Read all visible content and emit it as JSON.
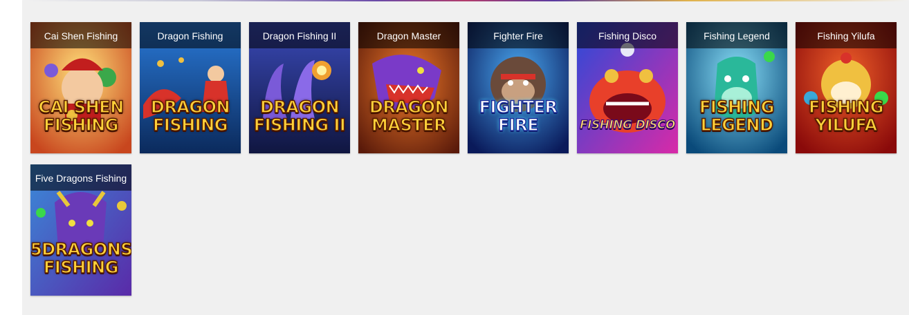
{
  "games": [
    {
      "title": "Cai Shen Fishing",
      "logo_line1": "CAI SHEN",
      "logo_line2": "FISHING",
      "colors": {
        "bg1": "#e8b23a",
        "bg2": "#c23a1e",
        "accent": "#3aa84a"
      },
      "art": "cai-shen-fishing-thumbnail"
    },
    {
      "title": "Dragon Fishing",
      "logo_line1": "DRAGON",
      "logo_line2": "FISHING",
      "colors": {
        "bg1": "#1d5fa8",
        "bg2": "#0b2a5c",
        "accent": "#d8322a"
      },
      "art": "dragon-fishing-thumbnail"
    },
    {
      "title": "Dragon Fishing II",
      "logo_line1": "DRAGON",
      "logo_line2": "FISHING II",
      "colors": {
        "bg1": "#2a2f8a",
        "bg2": "#101640",
        "accent": "#7a5ad8"
      },
      "art": "dragon-fishing-2-thumbnail"
    },
    {
      "title": "Dragon Master",
      "logo_line1": "DRAGON",
      "logo_line2": "MASTER",
      "colors": {
        "bg1": "#d65a1e",
        "bg2": "#5a1a0a",
        "accent": "#7a3ac8"
      },
      "art": "dragon-master-thumbnail"
    },
    {
      "title": "Fighter Fire",
      "logo_line1": "FIGHTER",
      "logo_line2": "FIRE",
      "colors": {
        "bg1": "#2a7ad8",
        "bg2": "#0a1a5a",
        "accent": "#7a5a3a"
      },
      "art": "fighter-fire-thumbnail"
    },
    {
      "title": "Fishing Disco",
      "logo_line1": "FISHING DISCO",
      "logo_line2": "",
      "colors": {
        "bg1": "#2a4ad8",
        "bg2": "#d82aa8",
        "accent": "#e8402a"
      },
      "art": "fishing-disco-thumbnail"
    },
    {
      "title": "Fishing Legend",
      "logo_line1": "FISHING",
      "logo_line2": "LEGEND",
      "colors": {
        "bg1": "#3ab8e8",
        "bg2": "#0a4a7a",
        "accent": "#2ab89a"
      },
      "art": "fishing-legend-thumbnail"
    },
    {
      "title": "Fishing Yilufa",
      "logo_line1": "FISHING",
      "logo_line2": "YILUFA",
      "colors": {
        "bg1": "#e83a1e",
        "bg2": "#8a0a0a",
        "accent": "#f0c040"
      },
      "art": "fishing-yilufa-thumbnail"
    },
    {
      "title": "Five Dragons Fishing",
      "logo_line1": "5DRAGONS",
      "logo_line2": "FISHING",
      "colors": {
        "bg1": "#3a8ad8",
        "bg2": "#5a2aa8",
        "accent": "#e8c83a"
      },
      "art": "five-dragons-fishing-thumbnail"
    }
  ]
}
